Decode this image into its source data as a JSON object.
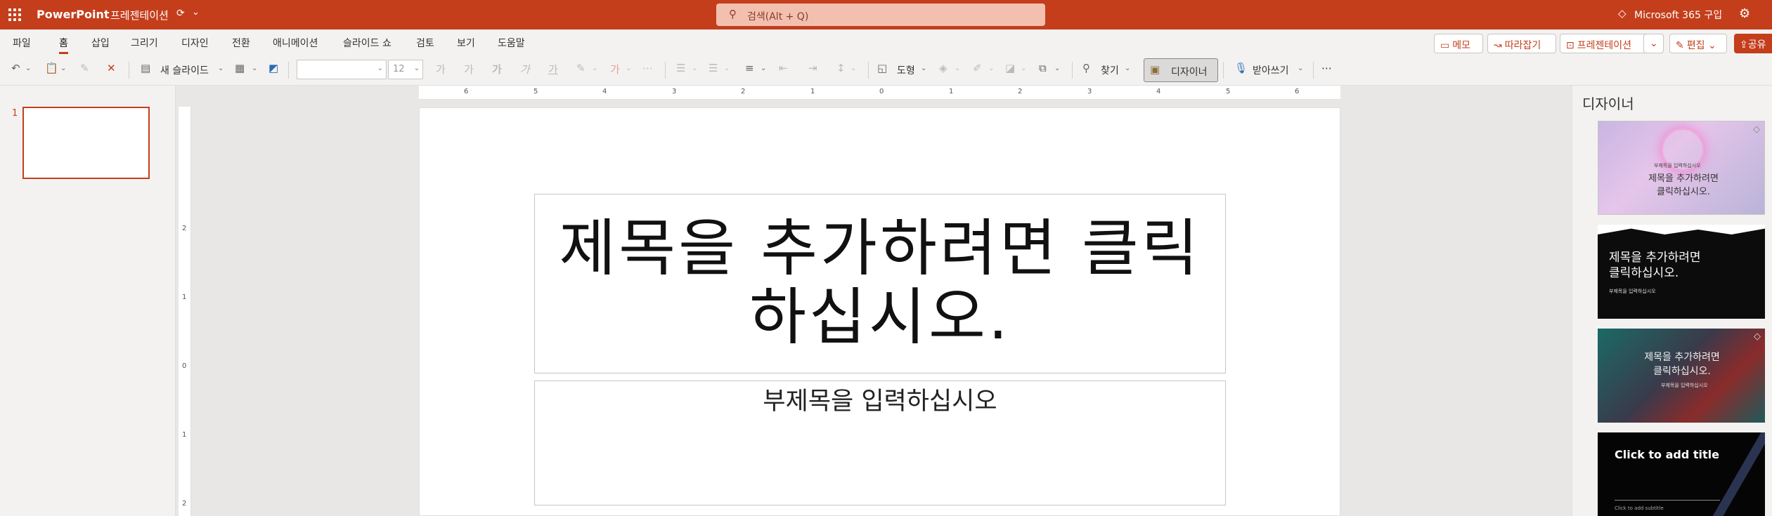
{
  "titlebar": {
    "app_name": "PowerPoint",
    "doc_name": "프레젠테이션",
    "search_placeholder": "검색(Alt + Q)",
    "m365_label": "Microsoft 365 구입"
  },
  "menu": {
    "tabs": [
      "파일",
      "홈",
      "삽입",
      "그리기",
      "디자인",
      "전환",
      "애니메이션",
      "슬라이드 쇼",
      "검토",
      "보기",
      "도움말"
    ],
    "active_tab": "홈",
    "comments": "메모",
    "catch_up": "따라잡기",
    "present": "프레젠테이션",
    "editing": "편집",
    "share": "공유"
  },
  "ribbon": {
    "new_slide": "새 슬라이드",
    "font_name": "",
    "font_size": "12",
    "shapes": "도형",
    "find": "찾기",
    "designer": "디자이너",
    "dictate": "받아쓰기"
  },
  "thumbnails": {
    "slide_number": "1"
  },
  "ruler": {
    "h_labels": [
      "6",
      "5",
      "4",
      "3",
      "2",
      "1",
      "0",
      "1",
      "2",
      "3",
      "4",
      "5",
      "6"
    ],
    "v_labels": [
      "2",
      "1",
      "0",
      "1",
      "2"
    ]
  },
  "slide": {
    "title_placeholder": "제목을 추가하려면 클릭하십시오.",
    "subtitle_placeholder": "부제목을 입력하십시오"
  },
  "designer": {
    "pane_title": "디자이너",
    "designs": [
      {
        "title": "제목을 추가하려면\n클릭하십시오.",
        "sub": "부제목을 입력하십시오"
      },
      {
        "title": "제목을 추가하려면\n클릭하십시오.",
        "sub": "부제목을 입력하십시오"
      },
      {
        "title": "제목을 추가하려면\n클릭하십시오.",
        "sub": "부제목을 입력하십시오"
      },
      {
        "title": "Click to add title",
        "sub": "Click to add subtitle"
      }
    ]
  },
  "colors": {
    "accent": "#c43e1c"
  }
}
